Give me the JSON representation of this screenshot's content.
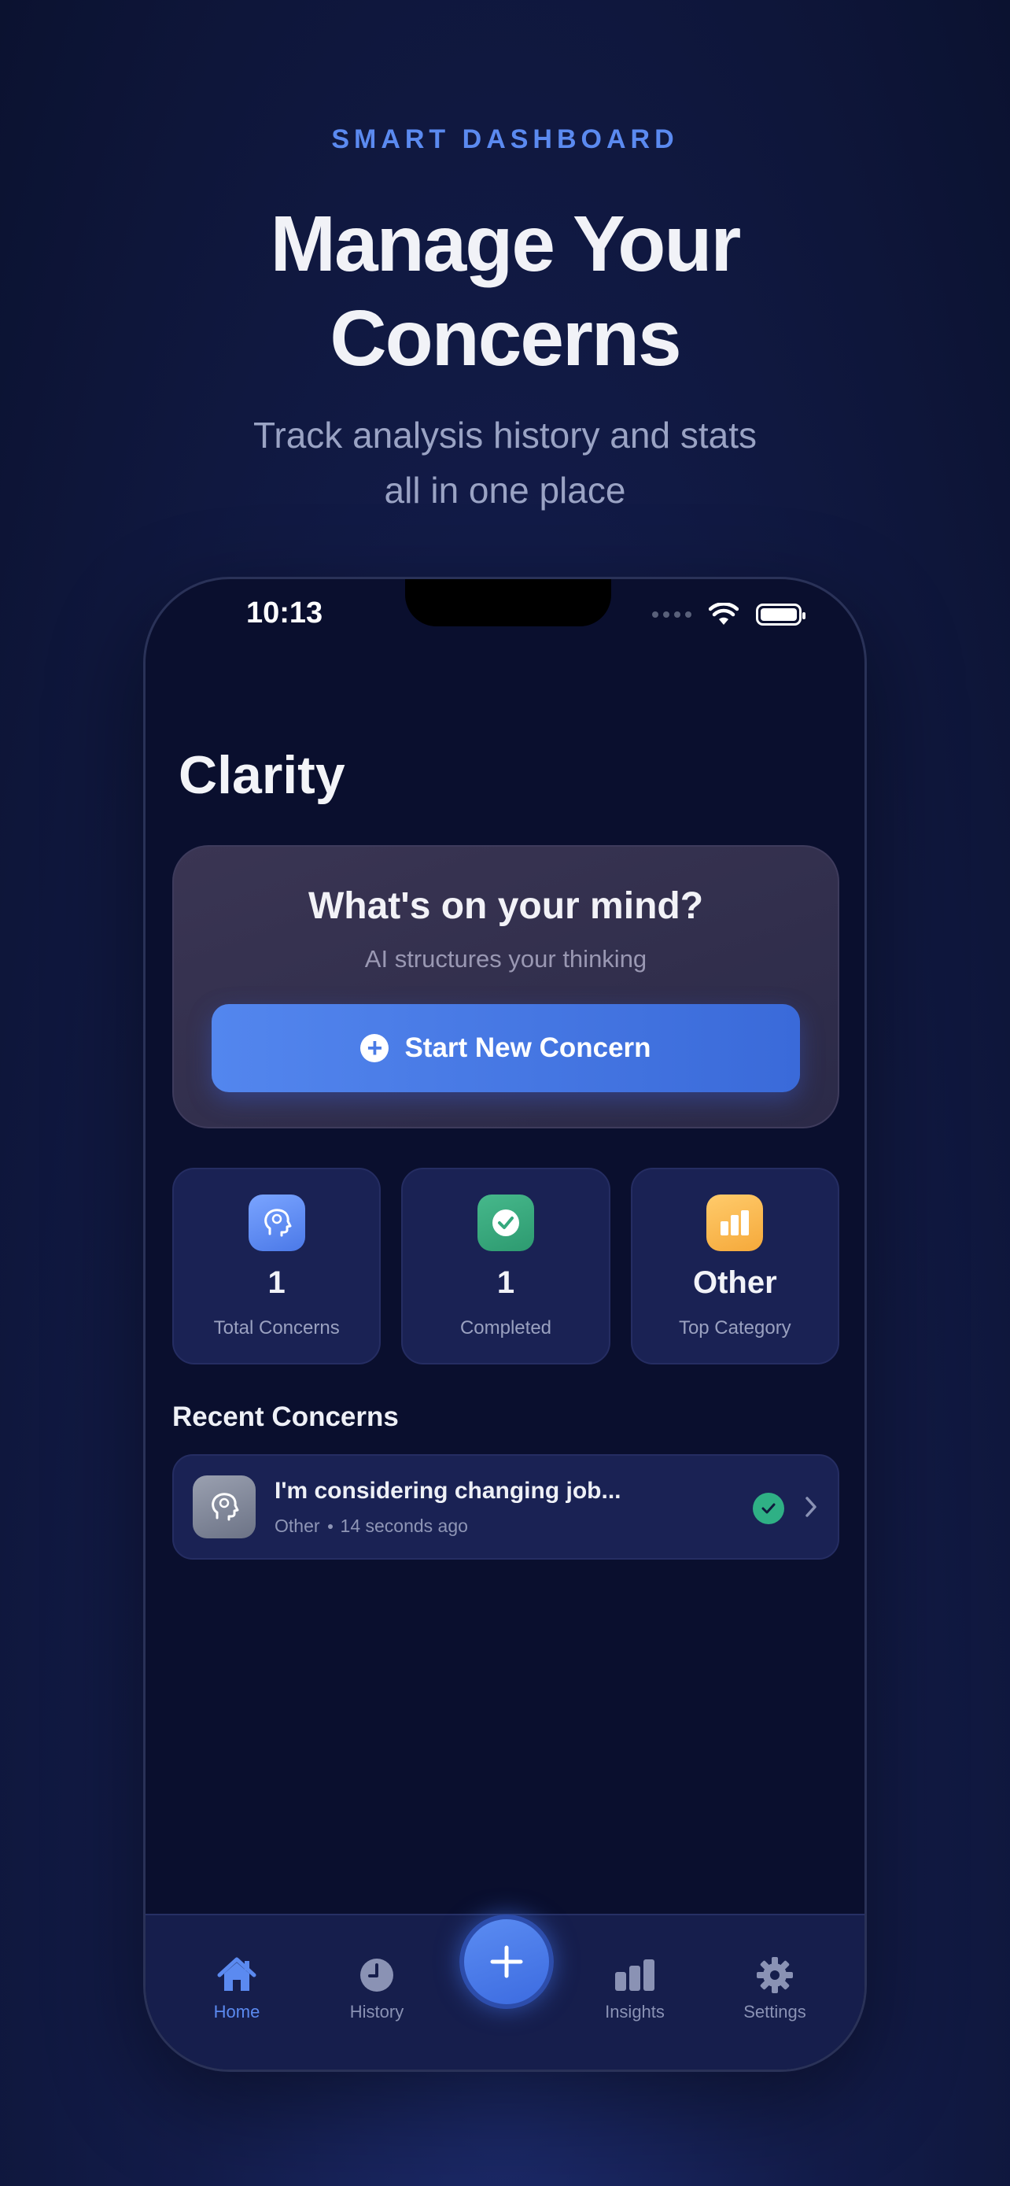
{
  "marketing": {
    "eyebrow": "SMART DASHBOARD",
    "headline_line1": "Manage Your",
    "headline_line2": "Concerns",
    "subhead_line1": "Track analysis history and stats",
    "subhead_line2": "all in one place"
  },
  "status_bar": {
    "time": "10:13"
  },
  "app": {
    "title": "Clarity"
  },
  "hero": {
    "title": "What's on your mind?",
    "subtitle": "AI structures your thinking",
    "cta_label": "Start New Concern"
  },
  "stats": [
    {
      "value": "1",
      "label": "Total Concerns",
      "icon": "brain-head-icon",
      "color": "#5b86ef"
    },
    {
      "value": "1",
      "label": "Completed",
      "icon": "check-circle-icon",
      "color": "#35a97d"
    },
    {
      "value": "Other",
      "label": "Top Category",
      "icon": "bar-chart-icon",
      "color": "#f7b34a"
    }
  ],
  "recent": {
    "section_title": "Recent Concerns",
    "items": [
      {
        "title": "I'm considering changing job...",
        "category": "Other",
        "time": "14 seconds ago",
        "status": "completed"
      }
    ]
  },
  "tabbar": {
    "items": [
      {
        "label": "Home",
        "icon": "home-icon",
        "active": true
      },
      {
        "label": "History",
        "icon": "clock-icon",
        "active": false
      },
      {
        "label": "Insights",
        "icon": "bar-chart-icon",
        "active": false
      },
      {
        "label": "Settings",
        "icon": "gear-icon",
        "active": false
      }
    ],
    "fab_icon": "plus-icon"
  },
  "colors": {
    "accent": "#5b8af0",
    "background": "#0a0f2e",
    "card": "#1a2254",
    "success": "#2fb085"
  }
}
